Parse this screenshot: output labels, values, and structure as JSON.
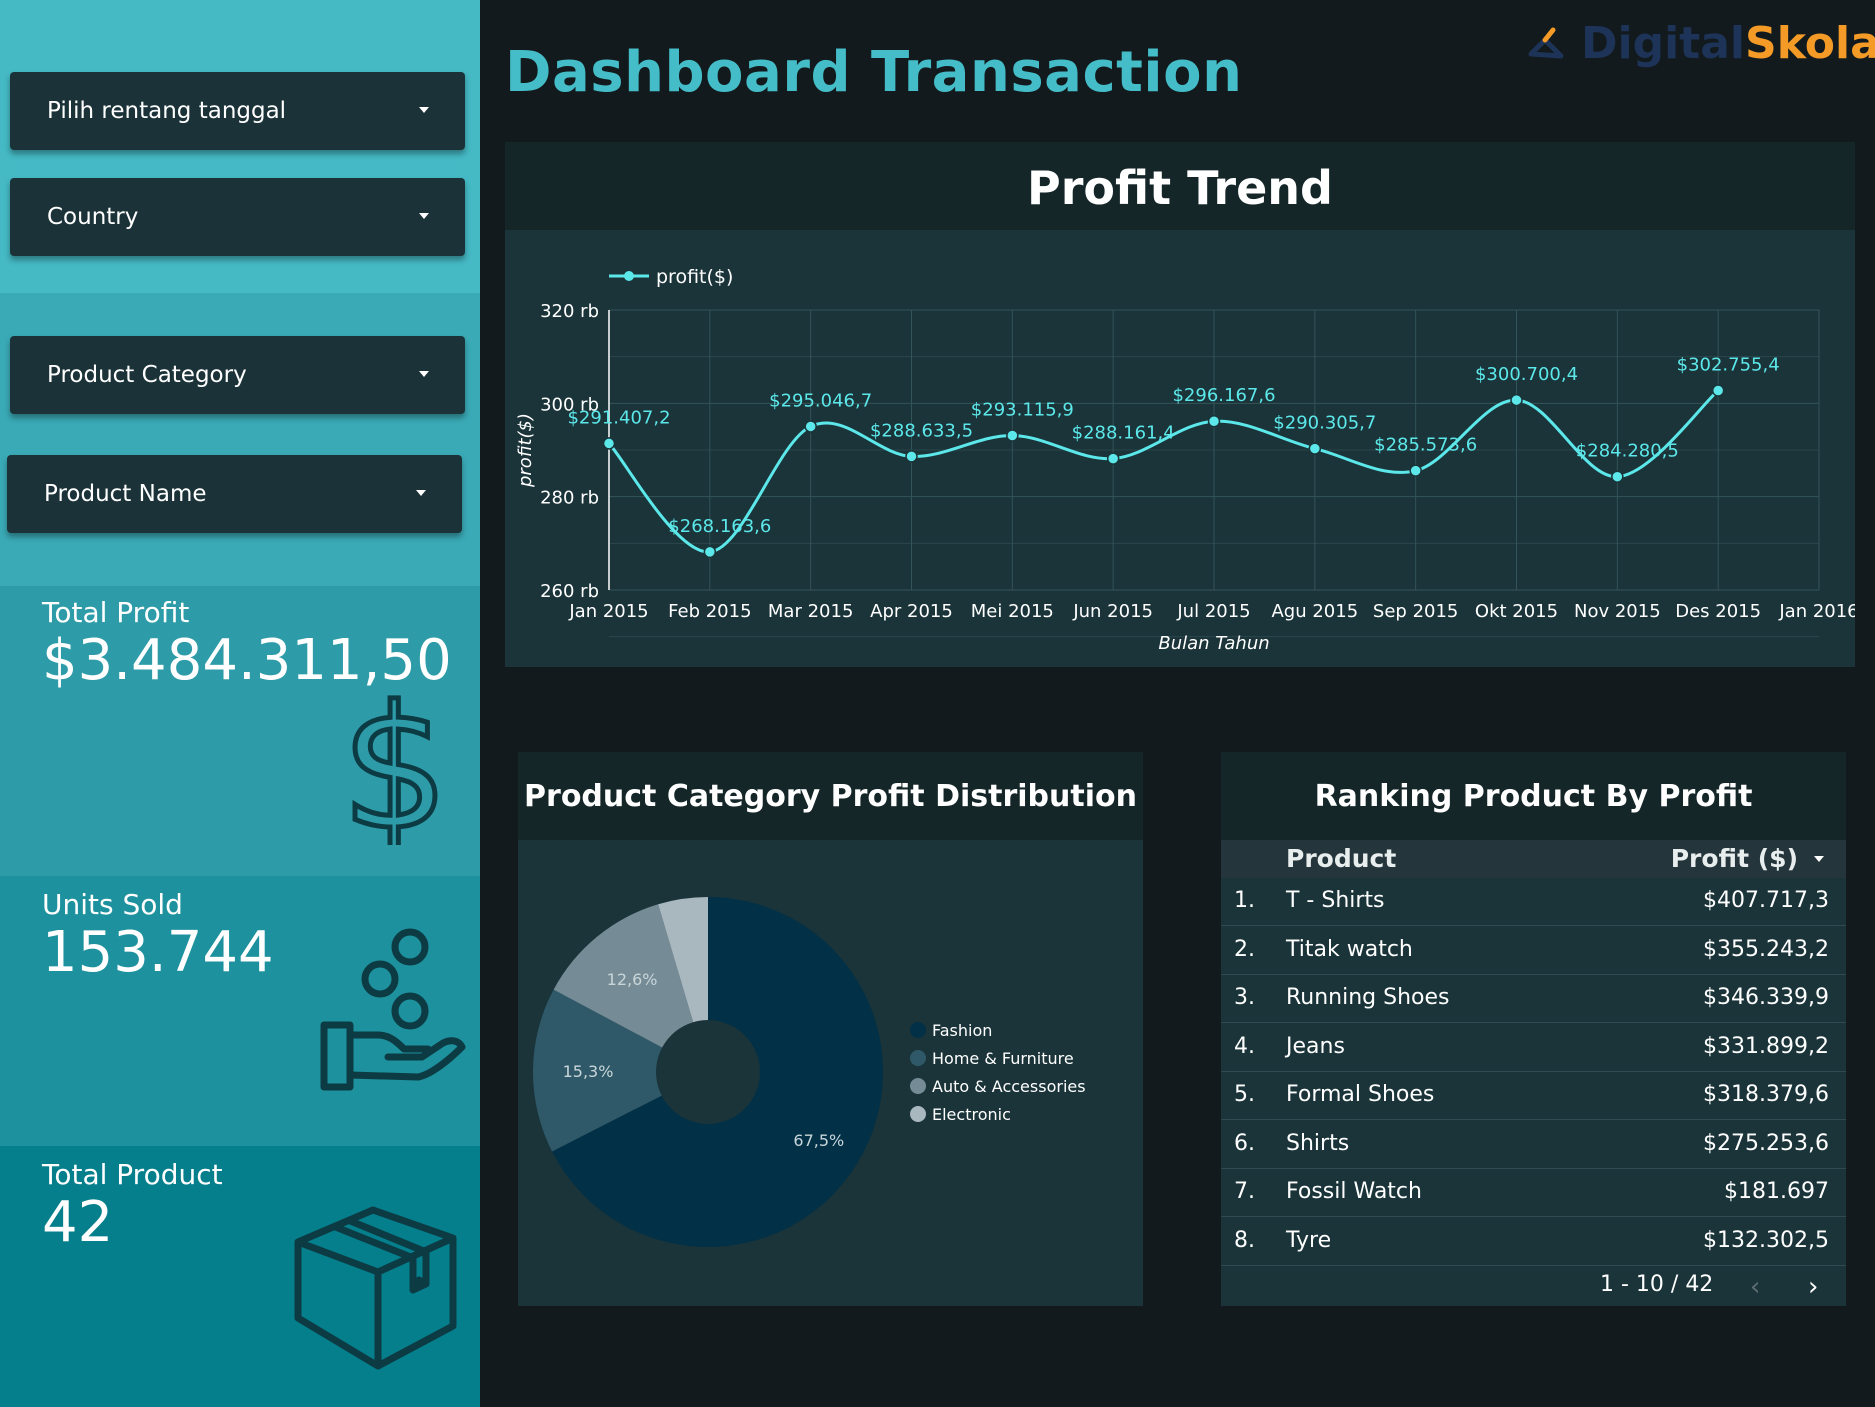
{
  "header": {
    "title": "Dashboard Transaction",
    "logo": {
      "part1": "Digital",
      "part2": "Skola"
    }
  },
  "filters": [
    {
      "label": "Pilih rentang tanggal"
    },
    {
      "label": "Country"
    },
    {
      "label": "Product Category"
    },
    {
      "label": "Product Name"
    }
  ],
  "kpis": {
    "total_profit": {
      "label": "Total Profit",
      "value": "$3.484.311,50"
    },
    "units_sold": {
      "label": "Units Sold",
      "value": "153.744"
    },
    "total_product": {
      "label": "Total Product",
      "value": "42"
    }
  },
  "colors": {
    "line": "#5ce8ea",
    "fashion": "#013047",
    "home": "#2f5969",
    "auto": "#758b96",
    "electronic": "#a9b7bf"
  },
  "chart_data": [
    {
      "type": "line",
      "title": "Profit Trend",
      "xlabel": "Bulan Tahun",
      "ylabel": "profit($)",
      "legend": "top-left",
      "ylim": [
        260000,
        320000
      ],
      "yticks": [
        {
          "value": 260000,
          "label": "260 rb"
        },
        {
          "value": 280000,
          "label": "280 rb"
        },
        {
          "value": 300000,
          "label": "300 rb"
        },
        {
          "value": 320000,
          "label": "320 rb"
        }
      ],
      "x_ticks": [
        "Jan 2015",
        "Feb 2015",
        "Mar 2015",
        "Apr 2015",
        "Mei 2015",
        "Jun 2015",
        "Jul 2015",
        "Agu 2015",
        "Sep 2015",
        "Okt 2015",
        "Nov 2015",
        "Des 2015",
        "Jan 2016"
      ],
      "grid": true,
      "series": [
        {
          "name": "profit($)",
          "x": [
            "Jan 2015",
            "Feb 2015",
            "Mar 2015",
            "Apr 2015",
            "Mei 2015",
            "Jun 2015",
            "Jul 2015",
            "Agu 2015",
            "Sep 2015",
            "Okt 2015",
            "Nov 2015",
            "Des 2015"
          ],
          "values": [
            291407.2,
            268163.6,
            295046.7,
            288633.5,
            293115.9,
            288161.4,
            296167.6,
            290305.7,
            285573.6,
            300700.4,
            284280.5,
            302755.4
          ],
          "labels": [
            "$291.407,2",
            "$268.163,6",
            "$295.046,7",
            "$288.633,5",
            "$293.115,9",
            "$288.161,4",
            "$296.167,6",
            "$290.305,7",
            "$285.573,6",
            "$300.700,4",
            "$284.280,5",
            "$302.755,4"
          ]
        }
      ]
    },
    {
      "type": "pie",
      "title": "Product Category Profit Distribution",
      "legend": "right",
      "slices": [
        {
          "name": "Fashion",
          "value": 67.5,
          "label": "67,5%"
        },
        {
          "name": "Home & Furniture",
          "value": 15.3,
          "label": "15,3%"
        },
        {
          "name": "Auto & Accessories",
          "value": 12.6,
          "label": "12,6%"
        },
        {
          "name": "Electronic",
          "value": 4.6,
          "label": ""
        }
      ]
    },
    {
      "type": "table",
      "title": "Ranking Product By Profit",
      "columns": [
        "Product",
        "Profit ($)"
      ],
      "rows": [
        {
          "rank": "1.",
          "product": "T - Shirts",
          "profit": "$407.717,3"
        },
        {
          "rank": "2.",
          "product": "Titak watch",
          "profit": "$355.243,2"
        },
        {
          "rank": "3.",
          "product": "Running Shoes",
          "profit": "$346.339,9"
        },
        {
          "rank": "4.",
          "product": "Jeans",
          "profit": "$331.899,2"
        },
        {
          "rank": "5.",
          "product": "Formal Shoes",
          "profit": "$318.379,6"
        },
        {
          "rank": "6.",
          "product": "Shirts",
          "profit": "$275.253,6"
        },
        {
          "rank": "7.",
          "product": "Fossil Watch",
          "profit": "$181.697"
        },
        {
          "rank": "8.",
          "product": "Tyre",
          "profit": "$132.302,5"
        }
      ],
      "pagination": "1 - 10 / 42"
    }
  ]
}
